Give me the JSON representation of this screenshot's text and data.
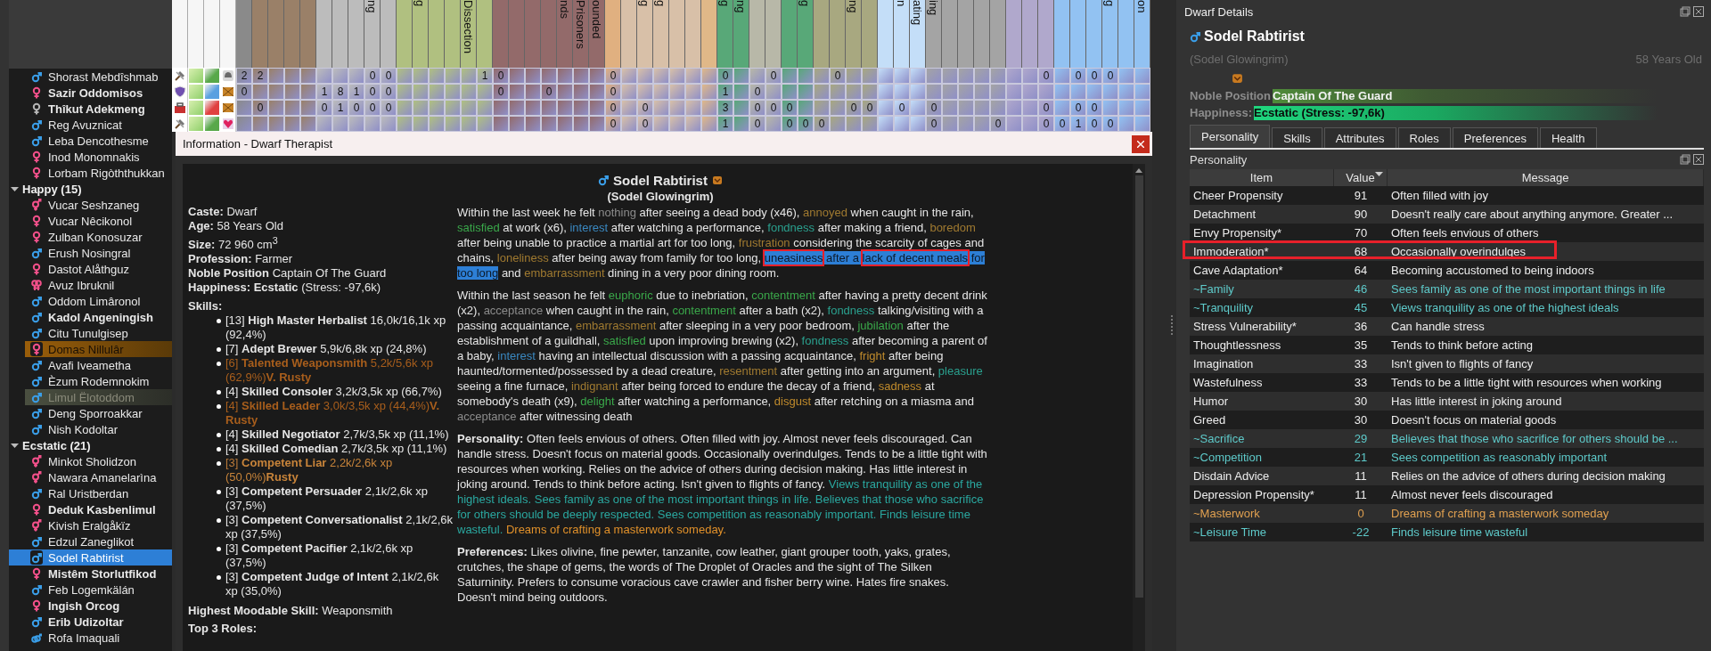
{
  "roster": [
    {
      "children": [
        {
          "kind": "male",
          "color": "#3a9ee8",
          "name": "Shorast Mebdîshmab",
          "bold": false,
          "flagged": false,
          "faded": false,
          "selected": false
        },
        {
          "kind": "female",
          "color": "#f2508a",
          "name": "Sazir Oddomisos",
          "bold": true,
          "flagged": false,
          "faded": false,
          "selected": false
        },
        {
          "kind": "female",
          "color": "#b4b4b4",
          "name": "Thîkut Adekmeng",
          "bold": true,
          "flagged": false,
          "faded": false,
          "selected": false
        },
        {
          "kind": "male",
          "color": "#3a9ee8",
          "name": "Reg Avuznicat",
          "bold": false,
          "flagged": false,
          "faded": false,
          "selected": false
        },
        {
          "kind": "male",
          "color": "#3a9ee8",
          "name": "Leba Dencothesme",
          "bold": false,
          "flagged": false,
          "faded": false,
          "selected": false
        },
        {
          "kind": "female",
          "color": "#f2508a",
          "name": "Inod Monomnakis",
          "bold": false,
          "flagged": false,
          "faded": false,
          "selected": false
        },
        {
          "kind": "female",
          "color": "#f2508a",
          "name": "Lorbam Rigòththukkan",
          "bold": false,
          "flagged": false,
          "faded": false,
          "selected": false
        }
      ]
    },
    {
      "label": "Happy (15)",
      "expanded": true,
      "children": [
        {
          "kind": "male_female",
          "color": "#f2508a",
          "name": "Vucar Seshzaneg",
          "bold": false,
          "flagged": false,
          "faded": false,
          "selected": false
        },
        {
          "kind": "female",
          "color": "#f2508a",
          "name": "Vucar Nêcikonol",
          "bold": false,
          "flagged": false,
          "faded": false,
          "selected": false
        },
        {
          "kind": "female",
          "color": "#f2508a",
          "name": "Zulban Konosuzar",
          "bold": false,
          "flagged": false,
          "faded": false,
          "selected": false
        },
        {
          "kind": "male",
          "color": "#3a9ee8",
          "name": "Erush Nosingral",
          "bold": false,
          "flagged": false,
          "faded": false,
          "selected": false
        },
        {
          "kind": "female",
          "color": "#f2508a",
          "name": "Dastot Alåthguz",
          "bold": false,
          "flagged": false,
          "faded": false,
          "selected": false
        },
        {
          "kind": "two_female",
          "color": "#f2508a",
          "name": "Avuz Ibruknil",
          "bold": false,
          "flagged": false,
          "faded": false,
          "selected": false
        },
        {
          "kind": "male",
          "color": "#3a9ee8",
          "name": "Oddom Limâronol",
          "bold": false,
          "flagged": false,
          "faded": false,
          "selected": false
        },
        {
          "kind": "male",
          "color": "#3a9ee8",
          "name": "Kadol Angeningish",
          "bold": true,
          "flagged": false,
          "faded": false,
          "selected": false
        },
        {
          "kind": "male",
          "color": "#3a9ee8",
          "name": "Citu Tunulgisep",
          "bold": false,
          "flagged": false,
          "faded": false,
          "selected": false
        },
        {
          "kind": "female",
          "color": "#f2508a",
          "name": "Domas Nillulâr",
          "bold": false,
          "flagged": true,
          "faded": false,
          "selected": false
        },
        {
          "kind": "male",
          "color": "#3a9ee8",
          "name": "Avafi Iveametha",
          "bold": false,
          "flagged": false,
          "faded": false,
          "selected": false
        },
        {
          "kind": "male",
          "color": "#3a9ee8",
          "name": "Èzum Rodemnokim",
          "bold": false,
          "flagged": false,
          "faded": false,
          "selected": false
        },
        {
          "kind": "male",
          "color": "#3a9ee8",
          "name": "Limul Ëlotoddom",
          "bold": false,
          "flagged": false,
          "faded": true,
          "selected": false
        },
        {
          "kind": "male",
          "color": "#3a9ee8",
          "name": "Deng Sporroakkar",
          "bold": false,
          "flagged": false,
          "faded": false,
          "selected": false
        },
        {
          "kind": "male",
          "color": "#3a9ee8",
          "name": "Nish Kodoltar",
          "bold": false,
          "flagged": false,
          "faded": false,
          "selected": false
        }
      ]
    },
    {
      "label": "Ecstatic (21)",
      "expanded": true,
      "children": [
        {
          "kind": "male_female",
          "color": "#f2508a",
          "name": "Minkot Sholidzon",
          "bold": false,
          "flagged": false,
          "faded": false,
          "selected": false
        },
        {
          "kind": "male_female",
          "color": "#f2508a",
          "name": "Nawara Amanelarìna",
          "bold": false,
          "flagged": false,
          "faded": false,
          "selected": false
        },
        {
          "kind": "male",
          "color": "#3a9ee8",
          "name": "Ral Uristberdan",
          "bold": false,
          "flagged": false,
          "faded": false,
          "selected": false
        },
        {
          "kind": "female",
          "color": "#f2508a",
          "name": "Deduk Kasbenlimul",
          "bold": true,
          "flagged": false,
          "faded": false,
          "selected": false
        },
        {
          "kind": "male_female",
          "color": "#f2508a",
          "name": "Kivish Eralgåkïz",
          "bold": false,
          "flagged": false,
          "faded": false,
          "selected": false
        },
        {
          "kind": "male",
          "color": "#3a9ee8",
          "name": "Edzul Zaneglikot",
          "bold": false,
          "flagged": false,
          "faded": false,
          "selected": false
        },
        {
          "kind": "male",
          "color": "#3a9ee8",
          "name": "Sodel Rabtirist",
          "bold": false,
          "flagged": false,
          "faded": false,
          "selected": true
        },
        {
          "kind": "female",
          "color": "#f2508a",
          "name": "Mistêm Storlutfikod",
          "bold": true,
          "flagged": false,
          "faded": false,
          "selected": false
        },
        {
          "kind": "male",
          "color": "#3a9ee8",
          "name": "Feb Logemkälán",
          "bold": false,
          "flagged": false,
          "faded": false,
          "selected": false
        },
        {
          "kind": "female",
          "color": "#f2508a",
          "name": "Ingish Orcog",
          "bold": true,
          "flagged": false,
          "faded": false,
          "selected": false
        },
        {
          "kind": "male",
          "color": "#3a9ee8",
          "name": "Erib Udizoltar",
          "bold": true,
          "flagged": false,
          "faded": false,
          "selected": false
        },
        {
          "kind": "two_male",
          "color": "#3a9ee8",
          "name": "Rofa Imaquali",
          "bold": false,
          "flagged": false,
          "faded": false,
          "selected": false
        }
      ]
    }
  ],
  "grid": {
    "columns": [
      {
        "color": "#8a8a8a"
      },
      {
        "color": "#9a8068"
      },
      {
        "color": "#9a8068"
      },
      {
        "color": "#9a8068"
      },
      {
        "color": "#9a8068"
      },
      {
        "color": "#bcbcbc"
      },
      {
        "color": "#bcbcbc"
      },
      {
        "color": "#bcbcbc"
      },
      {
        "color": "#bcbcbc",
        "label": "ng"
      },
      {
        "color": "#bcbcbc"
      },
      {
        "color": "#b0c080"
      },
      {
        "color": "#b0c080",
        "label": "g"
      },
      {
        "color": "#b0c080"
      },
      {
        "color": "#b0c080"
      },
      {
        "color": "#b0c080",
        "label": "Dissection"
      },
      {
        "color": "#b0c080"
      },
      {
        "color": "#936a6a"
      },
      {
        "color": "#936a6a"
      },
      {
        "color": "#936a6a"
      },
      {
        "color": "#936a6a"
      },
      {
        "color": "#936a6a",
        "label": "nds"
      },
      {
        "color": "#936a6a",
        "label": "Prisoners"
      },
      {
        "color": "#936a6a",
        "label": "ounded"
      },
      {
        "color": "#e0b080"
      },
      {
        "color": "#d8c0a8"
      },
      {
        "color": "#d8c0a8",
        "label": "g"
      },
      {
        "color": "#d8c0a8",
        "label": "g"
      },
      {
        "color": "#d8c0a8"
      },
      {
        "color": "#d8c0a8"
      },
      {
        "color": "#e0b888"
      },
      {
        "color": "#58a878",
        "label": "g"
      },
      {
        "color": "#58a878",
        "label": "ng"
      },
      {
        "color": "#b8b8a8"
      },
      {
        "color": "#b8b8a8"
      },
      {
        "color": "#58a878"
      },
      {
        "color": "#58a878",
        "label": "g"
      },
      {
        "color": "#a8a880"
      },
      {
        "color": "#a8a880"
      },
      {
        "color": "#a8a880",
        "label": "ng"
      },
      {
        "color": "#a8a880"
      },
      {
        "color": "#c4def8"
      },
      {
        "color": "#c4def8",
        "label": "n"
      },
      {
        "color": "#c4def8",
        "label": "ating"
      },
      {
        "color": "#a4a4a4",
        "label": "ing"
      },
      {
        "color": "#a4a4a4"
      },
      {
        "color": "#a4a4a4"
      },
      {
        "color": "#a4a4a4"
      },
      {
        "color": "#a4a4a4"
      },
      {
        "color": "#b0a8cc"
      },
      {
        "color": "#b0a8cc"
      },
      {
        "color": "#b0a8cc"
      },
      {
        "color": "#92c2f2"
      },
      {
        "color": "#92c2f2"
      },
      {
        "color": "#92c2f2"
      },
      {
        "color": "#92c2f2",
        "label": "g"
      },
      {
        "color": "#92c2f2"
      },
      {
        "color": "#92c2f2",
        "label": "on"
      }
    ],
    "rows": [
      {
        "profession": {
          "kind": "hammer"
        },
        "color": "#58a84a",
        "mood": {
          "kind": "helmet"
        },
        "cells": [
          "2",
          "2",
          null,
          null,
          null,
          null,
          null,
          null,
          "0",
          "0",
          null,
          null,
          null,
          null,
          null,
          "1",
          "0",
          null,
          null,
          null,
          null,
          null,
          null,
          "0",
          null,
          null,
          null,
          null,
          null,
          null,
          "0",
          null,
          null,
          "0",
          null,
          null,
          null,
          "0",
          null,
          null,
          null,
          null,
          null,
          null,
          null,
          null,
          null,
          null,
          null,
          null,
          "0",
          null,
          "0",
          "0",
          "0",
          null,
          null
        ]
      },
      {
        "profession": {
          "kind": "shield"
        },
        "color": "#5aa0e0",
        "mood": {
          "kind": "crate"
        },
        "cells": [
          "0",
          null,
          null,
          null,
          null,
          "1",
          "8",
          "1",
          "0",
          "0",
          null,
          null,
          null,
          null,
          null,
          null,
          "0",
          null,
          null,
          "0",
          null,
          null,
          null,
          "0",
          null,
          null,
          null,
          null,
          null,
          null,
          "1",
          null,
          "0",
          null,
          null,
          null,
          null,
          null,
          null,
          null,
          null,
          null,
          null,
          null,
          null,
          null,
          null,
          null,
          null,
          null,
          null,
          null,
          null,
          null,
          null,
          null,
          null
        ]
      },
      {
        "profession": {
          "kind": "toolbox"
        },
        "color": "#e04040",
        "mood": {
          "kind": "crate"
        },
        "cells": [
          null,
          "0",
          null,
          null,
          null,
          "0",
          "1",
          "0",
          "0",
          "0",
          null,
          null,
          null,
          null,
          null,
          null,
          null,
          null,
          null,
          null,
          null,
          null,
          null,
          "0",
          null,
          "0",
          null,
          null,
          null,
          null,
          "3",
          null,
          "0",
          "0",
          "0",
          null,
          null,
          null,
          "0",
          "0",
          null,
          "0",
          null,
          "0",
          null,
          null,
          null,
          null,
          null,
          null,
          "0",
          null,
          "0",
          "0",
          null,
          null,
          null
        ]
      },
      {
        "profession": {
          "kind": "hammer"
        },
        "color": "#58a84a",
        "mood": {
          "kind": "heart"
        },
        "cells": [
          null,
          null,
          null,
          null,
          null,
          null,
          null,
          null,
          null,
          null,
          null,
          null,
          null,
          null,
          null,
          null,
          null,
          null,
          null,
          null,
          null,
          null,
          null,
          "0",
          null,
          "0",
          null,
          null,
          null,
          null,
          "1",
          null,
          "0",
          null,
          "0",
          "0",
          "0",
          null,
          null,
          null,
          null,
          null,
          null,
          "0",
          null,
          null,
          null,
          "0",
          null,
          null,
          "0",
          "0",
          "1",
          "0",
          "0",
          null,
          null
        ]
      }
    ]
  },
  "dialog": {
    "title": "Information - Dwarf Therapist",
    "name": "Sodel Rabtirist",
    "alt_name": "(Sodel Glowingrim)",
    "facts": [
      {
        "label": "Caste:",
        "value": "Dwarf"
      },
      {
        "label": "Age:",
        "value": "58 Years Old"
      },
      {
        "label": "Size:",
        "value": "72 960 cm$^{3}$"
      },
      {
        "label": "Profession:",
        "value": "Farmer"
      },
      {
        "label": "Noble Position",
        "value": "Captain Of The Guard"
      },
      {
        "label": "Happiness:",
        "value": "**Ecstatic** (Stress: -97,6k)"
      }
    ],
    "skills_label": "Skills:",
    "skills": [
      {
        "kind": "plain",
        "level": "[13]",
        "name": "High Master Herbalist",
        "xp": "16,0k/16,1k xp (92,4%)"
      },
      {
        "kind": "plain",
        "level": "[7]",
        "name": "Adept Brewer",
        "xp": "5,9k/6,8k xp (24,8%)"
      },
      {
        "kind": "very_rusty",
        "level": "[6]",
        "name": "Talented Weaponsmith",
        "xp": "5,2k/5,6k xp (62,9%)",
        "rust_label": "V. Rusty"
      },
      {
        "kind": "plain",
        "level": "[4]",
        "name": "Skilled Consoler",
        "xp": "3,2k/3,5k xp (66,7%)"
      },
      {
        "kind": "very_rusty",
        "level": "[4]",
        "name": "Skilled Leader",
        "xp": "3,0k/3,5k xp (44,4%)",
        "rust_label": "V. Rusty"
      },
      {
        "kind": "plain",
        "level": "[4]",
        "name": "Skilled Negotiator",
        "xp": "2,7k/3,5k xp (11,1%)"
      },
      {
        "kind": "plain",
        "level": "[4]",
        "name": "Skilled Comedian",
        "xp": "2,7k/3,5k xp (11,1%)"
      },
      {
        "kind": "rusty",
        "level": "[3]",
        "name": "Competent Liar",
        "xp": "2,2k/2,6k xp (50,0%)",
        "rust_label": "Rusty"
      },
      {
        "kind": "plain",
        "level": "[3]",
        "name": "Competent Persuader",
        "xp": "2,1k/2,6k xp (37,5%)"
      },
      {
        "kind": "plain",
        "level": "[3]",
        "name": "Competent Conversationalist",
        "xp": "2,1k/2,6k xp (37,5%)"
      },
      {
        "kind": "plain",
        "level": "[3]",
        "name": "Competent Pacifier",
        "xp": "2,1k/2,6k xp (37,5%)"
      },
      {
        "kind": "plain",
        "level": "[3]",
        "name": "Competent Judge of Intent",
        "xp": "2,1k/2,6k xp (35,0%)"
      }
    ],
    "moodable": {
      "label": "Highest Moodable Skill:",
      "value": "Weaponsmith"
    },
    "roles_label": "Top 3 Roles:",
    "paragraphs": [
      [
        {
          "kind": "plain",
          "text": "Within the last week he felt "
        },
        {
          "kind": "emotion",
          "color": "#8c8c8c",
          "text": "nothing"
        },
        {
          "kind": "plain",
          "text": " after seeing a dead body (x46), "
        },
        {
          "kind": "emotion",
          "color": "#a07a30",
          "text": "annoyed"
        },
        {
          "kind": "plain",
          "text": " when caught in the rain, "
        },
        {
          "kind": "emotion",
          "color": "#3aa84a",
          "text": "satisfied"
        },
        {
          "kind": "plain",
          "text": " at work (x6), "
        },
        {
          "kind": "emotion",
          "color": "#3a88c0",
          "text": "interest"
        },
        {
          "kind": "plain",
          "text": " after watching a performance, "
        },
        {
          "kind": "emotion",
          "color": "#2aa08e",
          "text": "fondness"
        },
        {
          "kind": "plain",
          "text": " after making a friend, "
        },
        {
          "kind": "emotion",
          "color": "#a07a30",
          "text": "boredom"
        },
        {
          "kind": "plain",
          "text": " after being unable to practice a martial art for too long, "
        },
        {
          "kind": "emotion",
          "color": "#a07a30",
          "text": "frustration"
        },
        {
          "kind": "plain",
          "text": " considering the scarcity of cages and chains, "
        },
        {
          "kind": "emotion",
          "color": "#a07a30",
          "text": "loneliness"
        },
        {
          "kind": "plain",
          "text": " after being away from family for too long, "
        },
        {
          "kind": "selected_boxed",
          "text": "uneasiness"
        },
        {
          "kind": "selected",
          "text": " after a "
        },
        {
          "kind": "selected_boxed",
          "text": "lack of decent meals"
        },
        {
          "kind": "selected",
          "text": " for too long"
        },
        {
          "kind": "plain",
          "text": " and "
        },
        {
          "kind": "emotion",
          "color": "#a07a30",
          "text": "embarrassment"
        },
        {
          "kind": "plain",
          "text": " dining in a very poor dining room."
        }
      ],
      [
        {
          "kind": "plain",
          "text": "Within the last season he felt "
        },
        {
          "kind": "emotion",
          "color": "#3aa84a",
          "text": "euphoric"
        },
        {
          "kind": "plain",
          "text": " due to inebriation, "
        },
        {
          "kind": "emotion",
          "color": "#3aa84a",
          "text": "contentment"
        },
        {
          "kind": "plain",
          "text": " after having a pretty decent drink (x2), "
        },
        {
          "kind": "emotion",
          "color": "#8c8c8c",
          "text": "acceptance"
        },
        {
          "kind": "plain",
          "text": " when caught in the rain, "
        },
        {
          "kind": "emotion",
          "color": "#3aa84a",
          "text": "contentment"
        },
        {
          "kind": "plain",
          "text": " after a bath (x2), "
        },
        {
          "kind": "emotion",
          "color": "#2aa08e",
          "text": "fondness"
        },
        {
          "kind": "plain",
          "text": " talking/visiting with a passing acquaintance, "
        },
        {
          "kind": "emotion",
          "color": "#a07a30",
          "text": "embarrassment"
        },
        {
          "kind": "plain",
          "text": " after sleeping in a very poor bedroom, "
        },
        {
          "kind": "emotion",
          "color": "#3aa84a",
          "text": "jubilation"
        },
        {
          "kind": "plain",
          "text": " after the establishment of a guildhall, "
        },
        {
          "kind": "emotion",
          "color": "#3aa84a",
          "text": "satisfied"
        },
        {
          "kind": "plain",
          "text": " upon improving brewing (x2), "
        },
        {
          "kind": "emotion",
          "color": "#2aa08e",
          "text": "fondness"
        },
        {
          "kind": "plain",
          "text": " after becoming a parent of a baby, "
        },
        {
          "kind": "emotion",
          "color": "#3a88c0",
          "text": "interest"
        },
        {
          "kind": "plain",
          "text": " having an intellectual discussion with a passing acquaintance, "
        },
        {
          "kind": "emotion",
          "color": "#c08b2c",
          "text": "fright"
        },
        {
          "kind": "plain",
          "text": " after being haunted/tormented/possessed by a dead creature, "
        },
        {
          "kind": "emotion",
          "color": "#a07a30",
          "text": "resentment"
        },
        {
          "kind": "plain",
          "text": " after getting into an argument, "
        },
        {
          "kind": "emotion",
          "color": "#2aa08e",
          "text": "pleasure"
        },
        {
          "kind": "plain",
          "text": " seeing a fine furnace, "
        },
        {
          "kind": "emotion",
          "color": "#a07a30",
          "text": "indignant"
        },
        {
          "kind": "plain",
          "text": " after being forced to endure the decay of a friend, "
        },
        {
          "kind": "emotion",
          "color": "#c08b2c",
          "text": "sadness"
        },
        {
          "kind": "plain",
          "text": " at somebody's death (x9), "
        },
        {
          "kind": "emotion",
          "color": "#3aa84a",
          "text": "delight"
        },
        {
          "kind": "plain",
          "text": " after watching a performance, "
        },
        {
          "kind": "emotion",
          "color": "#c08b2c",
          "text": "disgust"
        },
        {
          "kind": "plain",
          "text": " after retching on a miasma and "
        },
        {
          "kind": "emotion",
          "color": "#8c8c8c",
          "text": "acceptance"
        },
        {
          "kind": "plain",
          "text": " after witnessing death"
        }
      ],
      [
        {
          "kind": "label",
          "text": "Personality:"
        },
        {
          "kind": "plain",
          "text": " Often feels envious of others. Often filled with joy. Almost never feels discouraged. Can handle stress. Doesn't focus on material goods. Occasionally overindulges. Tends to be a little tight with resources when working. Relies on the advice of others during decision making. Has little interest in joking around. Tends to think before acting. Isn't given to flights of fancy. "
        },
        {
          "kind": "emotion",
          "color": "#2aa8a0",
          "text": "Views tranquility as one of the highest ideals. Sees family as one of the most important things in life. Believes that those who sacrifice for others should be deeply respected. Sees competition as reasonably important. Finds leisure time wasteful."
        },
        {
          "kind": "emotion",
          "color": "#e0902a",
          "text": " Dreams of crafting a masterwork someday."
        }
      ],
      [
        {
          "kind": "label",
          "text": "Preferences:"
        },
        {
          "kind": "plain",
          "text": " Likes olivine, fine pewter, tanzanite, cow leather, giant grouper tooth, yaks, grates, crutches, the shape of gems, the words of The Droplet of Oracles and the sight of The Silken Saturninity. Prefers to consume voracious cave crawler and fisher berry wine. Hates fire snakes. Doesn't mind being outdoors."
        }
      ]
    ]
  },
  "details": {
    "title": "Dwarf Details",
    "name": "Sodel Rabtirist",
    "alt_name": "(Sodel Glowingrim)",
    "age": "58 Years Old",
    "noble_label": "Noble Position",
    "noble_value": "Captain Of The Guard",
    "happiness_label": "Happiness:",
    "happiness_value": "Ecstatic (Stress: -97,6k)",
    "tabs": [
      {
        "label": "Personality",
        "selected": true
      },
      {
        "label": "Skills",
        "selected": false
      },
      {
        "label": "Attributes",
        "selected": false
      },
      {
        "label": "Roles",
        "selected": false
      },
      {
        "label": "Preferences",
        "selected": false
      },
      {
        "label": "Health",
        "selected": false
      }
    ],
    "section": "Personality",
    "columns": [
      {
        "label": "Item",
        "sorted": false
      },
      {
        "label": "Value",
        "sorted": true
      },
      {
        "label": "Message",
        "sorted": false
      }
    ],
    "rows": [
      {
        "item": "Cheer Propensity",
        "value": "91",
        "message": "Often filled with joy",
        "kind": "trait",
        "boxed": false
      },
      {
        "item": "Detachment",
        "value": "90",
        "message": "Doesn't really care about anything anymore. Greater ...",
        "kind": "trait",
        "boxed": false
      },
      {
        "item": "Envy Propensity*",
        "value": "70",
        "message": "Often feels envious of others",
        "kind": "trait",
        "boxed": false
      },
      {
        "item": "Immoderation*",
        "value": "68",
        "message": "Occasionally overindulges",
        "kind": "trait",
        "boxed": true
      },
      {
        "item": "Cave Adaptation*",
        "value": "64",
        "message": "Becoming accustomed to being indoors",
        "kind": "trait",
        "boxed": false
      },
      {
        "item": "~Family",
        "value": "46",
        "message": "Sees family as one of the most important things in life",
        "kind": "belief",
        "boxed": false
      },
      {
        "item": "~Tranquility",
        "value": "45",
        "message": "Views tranquility as one of the highest ideals",
        "kind": "belief",
        "boxed": false
      },
      {
        "item": "Stress Vulnerability*",
        "value": "36",
        "message": "Can handle stress",
        "kind": "trait",
        "boxed": false
      },
      {
        "item": "Thoughtlessness",
        "value": "35",
        "message": "Tends to think before acting",
        "kind": "trait",
        "boxed": false
      },
      {
        "item": "Imagination",
        "value": "33",
        "message": "Isn't given to flights of fancy",
        "kind": "trait",
        "boxed": false
      },
      {
        "item": "Wastefulness",
        "value": "33",
        "message": "Tends to be a little tight with resources when working",
        "kind": "trait",
        "boxed": false
      },
      {
        "item": "Humor",
        "value": "30",
        "message": "Has little interest in joking around",
        "kind": "trait",
        "boxed": false
      },
      {
        "item": "Greed",
        "value": "30",
        "message": "Doesn't focus on material goods",
        "kind": "trait",
        "boxed": false
      },
      {
        "item": "~Sacrifice",
        "value": "29",
        "message": "Believes that those who sacrifice for others should be ...",
        "kind": "belief",
        "boxed": false
      },
      {
        "item": "~Competition",
        "value": "21",
        "message": "Sees competition as reasonably important",
        "kind": "belief",
        "boxed": false
      },
      {
        "item": "Disdain Advice",
        "value": "11",
        "message": "Relies on the advice of others during decision making",
        "kind": "trait",
        "boxed": false
      },
      {
        "item": "Depression Propensity*",
        "value": "11",
        "message": "Almost never feels discouraged",
        "kind": "trait",
        "boxed": false
      },
      {
        "item": "~Masterwork",
        "value": "0",
        "message": "Dreams of crafting a masterwork someday",
        "kind": "goal",
        "boxed": false
      },
      {
        "item": "~Leisure Time",
        "value": "-22",
        "message": "Finds leisure time wasteful",
        "kind": "belief",
        "boxed": false
      }
    ]
  }
}
